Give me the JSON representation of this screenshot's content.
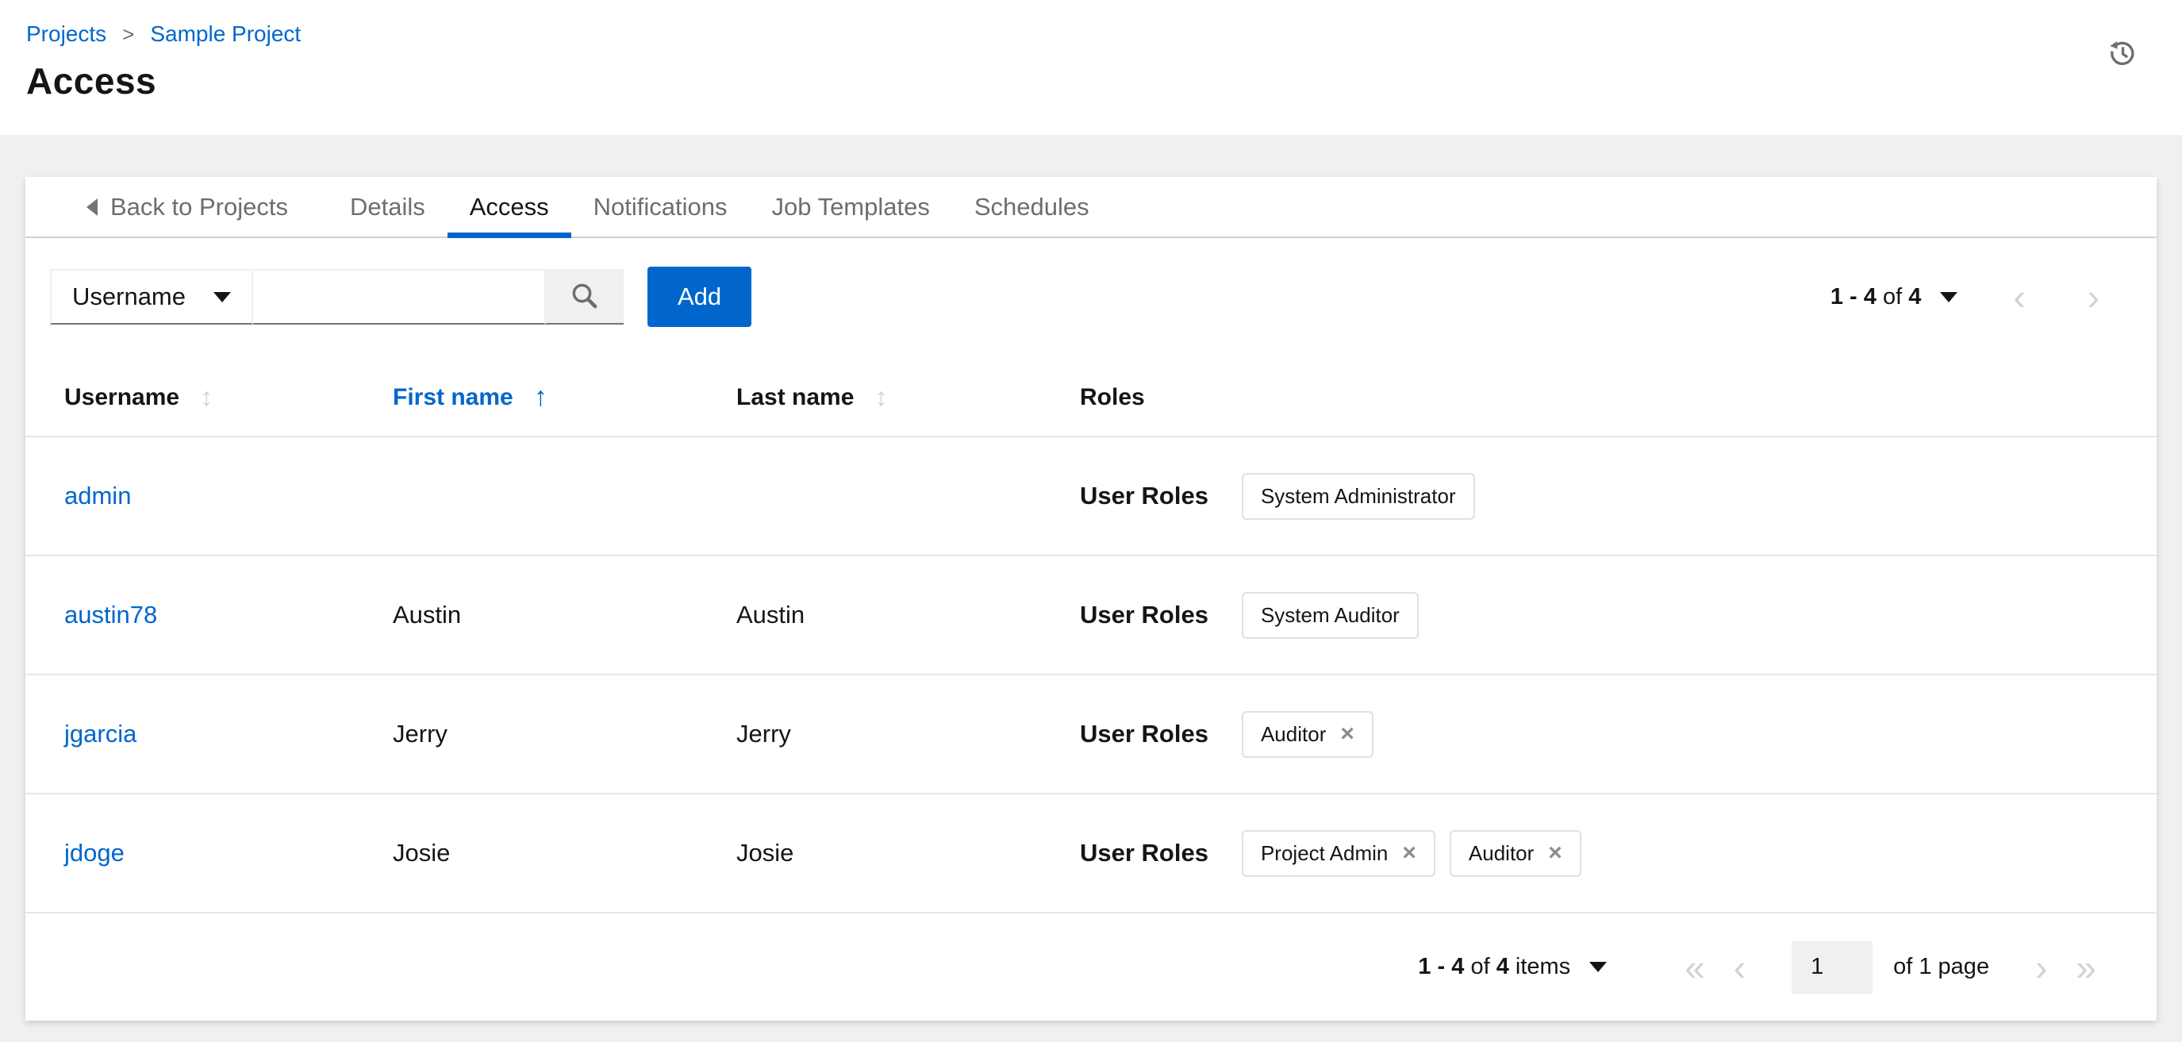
{
  "colors": {
    "primary_blue": "#0066cc",
    "text_dark": "#151515",
    "text_gray": "#6a6e73",
    "disabled_gray": "#d2d2d2"
  },
  "icons": {
    "breadcrumb_separator": ">",
    "sort_inactive": "↕",
    "sort_ascending": "↑",
    "angle_left": "‹",
    "angle_right": "›",
    "angle_double_left": "«",
    "angle_double_right": "»",
    "remove": "×"
  },
  "header": {
    "breadcrumb": {
      "projects": "Projects",
      "current": "Sample Project"
    },
    "title": "Access"
  },
  "tabs": {
    "back_label": "Back to Projects",
    "active": "Access",
    "items": [
      {
        "label": "Details"
      },
      {
        "label": "Access"
      },
      {
        "label": "Notifications"
      },
      {
        "label": "Job Templates"
      },
      {
        "label": "Schedules"
      }
    ]
  },
  "toolbar": {
    "filter_key": "Username",
    "search_value": "",
    "add_label": "Add"
  },
  "pagination_top": {
    "range": "1 - 4",
    "of_word": "of",
    "total": "4"
  },
  "table": {
    "headers": {
      "username": "Username",
      "first_name": "First name",
      "last_name": "Last name",
      "roles": "Roles"
    },
    "rows": [
      {
        "username": "admin",
        "first": "",
        "last": "",
        "roles_label": "User Roles",
        "chips": [
          {
            "label": "System Administrator",
            "removable": false
          }
        ]
      },
      {
        "username": "austin78",
        "first": "Austin",
        "last": "Austin",
        "roles_label": "User Roles",
        "chips": [
          {
            "label": "System Auditor",
            "removable": false
          }
        ]
      },
      {
        "username": "jgarcia",
        "first": "Jerry",
        "last": "Jerry",
        "roles_label": "User Roles",
        "chips": [
          {
            "label": "Auditor",
            "removable": true
          }
        ]
      },
      {
        "username": "jdoge",
        "first": "Josie",
        "last": "Josie",
        "roles_label": "User Roles",
        "chips": [
          {
            "label": "Project Admin",
            "removable": true
          },
          {
            "label": "Auditor",
            "removable": true
          }
        ]
      }
    ]
  },
  "pagination_bottom": {
    "range": "1 - 4",
    "of_word": "of",
    "total": "4",
    "items_word": "items",
    "page_value": "1",
    "of_pages": "of 1 page"
  }
}
